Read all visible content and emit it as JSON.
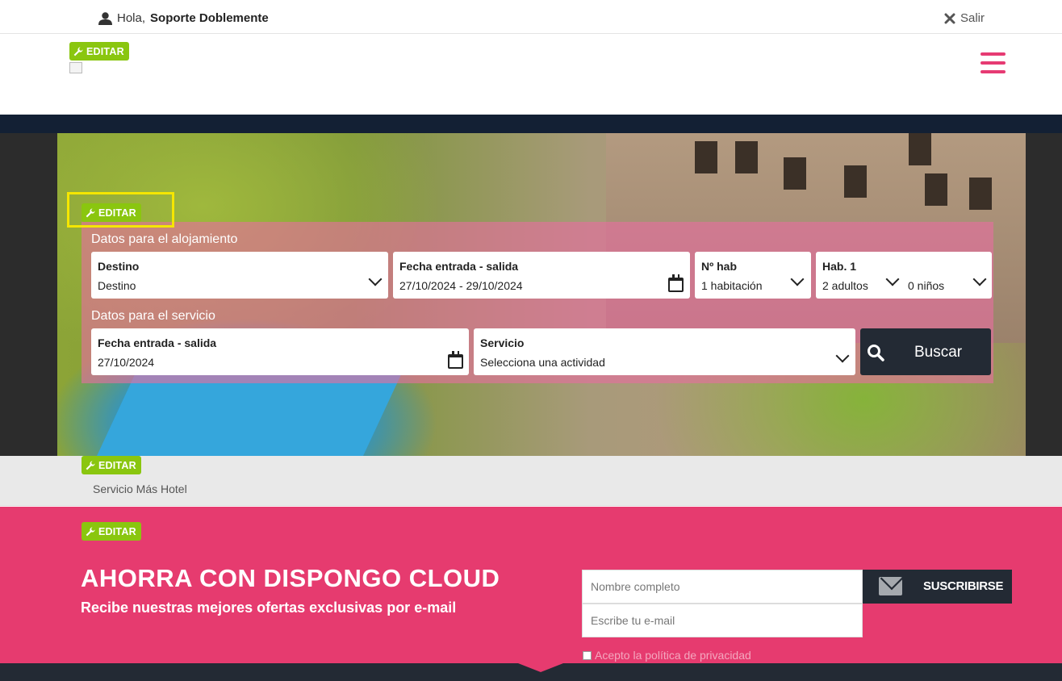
{
  "userbar": {
    "greeting": "Hola,",
    "username": "Soporte Doblemente",
    "logout": "Salir"
  },
  "edit_label": "EDITAR",
  "search": {
    "lodging_title": "Datos para el alojamiento",
    "service_title": "Datos para el servicio",
    "destino": {
      "title": "Destino",
      "value": "Destino"
    },
    "fechas_aloj": {
      "title": "Fecha entrada - salida",
      "value": "27/10/2024 - 29/10/2024"
    },
    "habitaciones": {
      "title": "Nº hab",
      "value": "1 habitación"
    },
    "hab1": {
      "title": "Hab. 1",
      "adults": "2 adultos",
      "children": "0 niños"
    },
    "fechas_serv": {
      "title": "Fecha entrada - salida",
      "value": "27/10/2024"
    },
    "servicio": {
      "title": "Servicio",
      "value": "Selecciona una actividad"
    },
    "buscar": "Buscar"
  },
  "graybar": {
    "service_text": "Servicio Más Hotel"
  },
  "newsletter": {
    "title": "AHORRA CON DISPONGO CLOUD",
    "subtitle": "Recibe nuestras mejores ofertas exclusivas por e-mail",
    "name_placeholder": "Nombre completo",
    "email_placeholder": "Escribe tu e-mail",
    "subscribe": "SUSCRIBIRSE",
    "privacy": "Acepto la política de privacidad"
  },
  "colors": {
    "accent_pink": "#e63b6f",
    "edit_green": "#8ac60f",
    "navy": "#132034",
    "dark_button": "#232a34"
  },
  "icons": [
    "user-icon",
    "close-icon",
    "wrench-icon",
    "hamburger-icon",
    "chevron-down-icon",
    "calendar-icon",
    "search-icon",
    "envelope-icon"
  ]
}
